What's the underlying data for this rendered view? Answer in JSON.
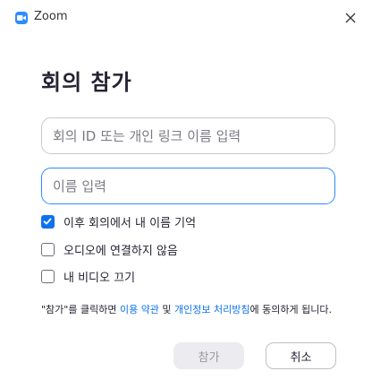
{
  "window": {
    "title": "Zoom",
    "app_icon": "zoom-camera-icon",
    "close_icon": "close-icon"
  },
  "heading": "회의 참가",
  "inputs": {
    "meeting_id": {
      "value": "",
      "placeholder": "회의 ID 또는 개인 링크 이름 입력"
    },
    "name": {
      "value": "",
      "placeholder": "이름 입력"
    }
  },
  "options": [
    {
      "label": "이후 회의에서 내 이름 기억",
      "checked": true
    },
    {
      "label": "오디오에 연결하지 않음",
      "checked": false
    },
    {
      "label": "내 비디오 끄기",
      "checked": false
    }
  ],
  "terms": {
    "prefix": "\"참가\"를 클릭하면 ",
    "terms_link": "이용 약관",
    "middle": " 및 ",
    "privacy_link": "개인정보 처리방침",
    "suffix": "에 동의하게 됩니다."
  },
  "buttons": {
    "join": "참가",
    "cancel": "취소"
  },
  "colors": {
    "accent": "#0e72ed",
    "brand": "#2d8cff"
  }
}
